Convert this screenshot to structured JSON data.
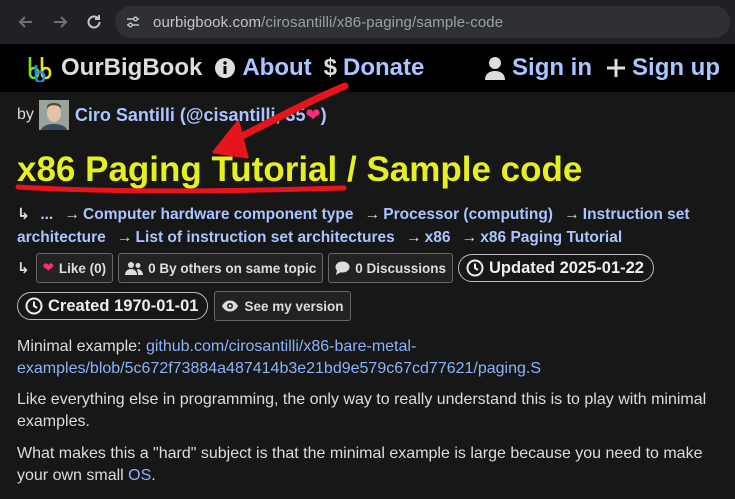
{
  "browser": {
    "url_host": "ourbigbook.com",
    "url_path": "/cirosantilli/x86-paging/sample-code"
  },
  "nav": {
    "brand": "OurBigBook",
    "about": "About",
    "donate": "Donate",
    "sign_in": "Sign in",
    "sign_up": "Sign up"
  },
  "byline": {
    "by": "by",
    "author_prefix": "Ciro Santilli (@ci",
    "author_suffix": "santilli, 35",
    "close": ")"
  },
  "title": {
    "parent": "x86 Paging Tutorial",
    "separator": " / ",
    "current": "Sample code"
  },
  "breadcrumbs": {
    "start": "↳",
    "items": [
      "...",
      "Computer hardware component type",
      "Processor (computing)",
      "Instruction set architecture",
      "List of instruction set architectures",
      "x86",
      "x86 Paging Tutorial"
    ]
  },
  "actions": {
    "start": "↳",
    "like": "Like (0)",
    "others": "0 By others on same topic",
    "discussions": "0 Discussions",
    "updated": "Updated 2025-01-22",
    "created": "Created 1970-01-01",
    "see_version": "See my version"
  },
  "body": {
    "p1_prefix": "Minimal example: ",
    "p1_link_line1": "github.com/cirosantilli/x86-bare-metal-",
    "p1_link_line2": "examples/blob/5c672f73884a487414b3e21bd9e579c67cd77621/paging.S",
    "p2": "Like everything else in programming, the only way to really understand this is to play with minimal examples.",
    "p3_prefix": "What makes this a \"hard\" subject is that the minimal example is large because you need to make your own small ",
    "p3_link": "OS",
    "p3_suffix": "."
  },
  "colors": {
    "title": "#e6f01d",
    "link": "#aac5ff",
    "annotation": "#e8141c",
    "heart": "#ff2a7a"
  }
}
